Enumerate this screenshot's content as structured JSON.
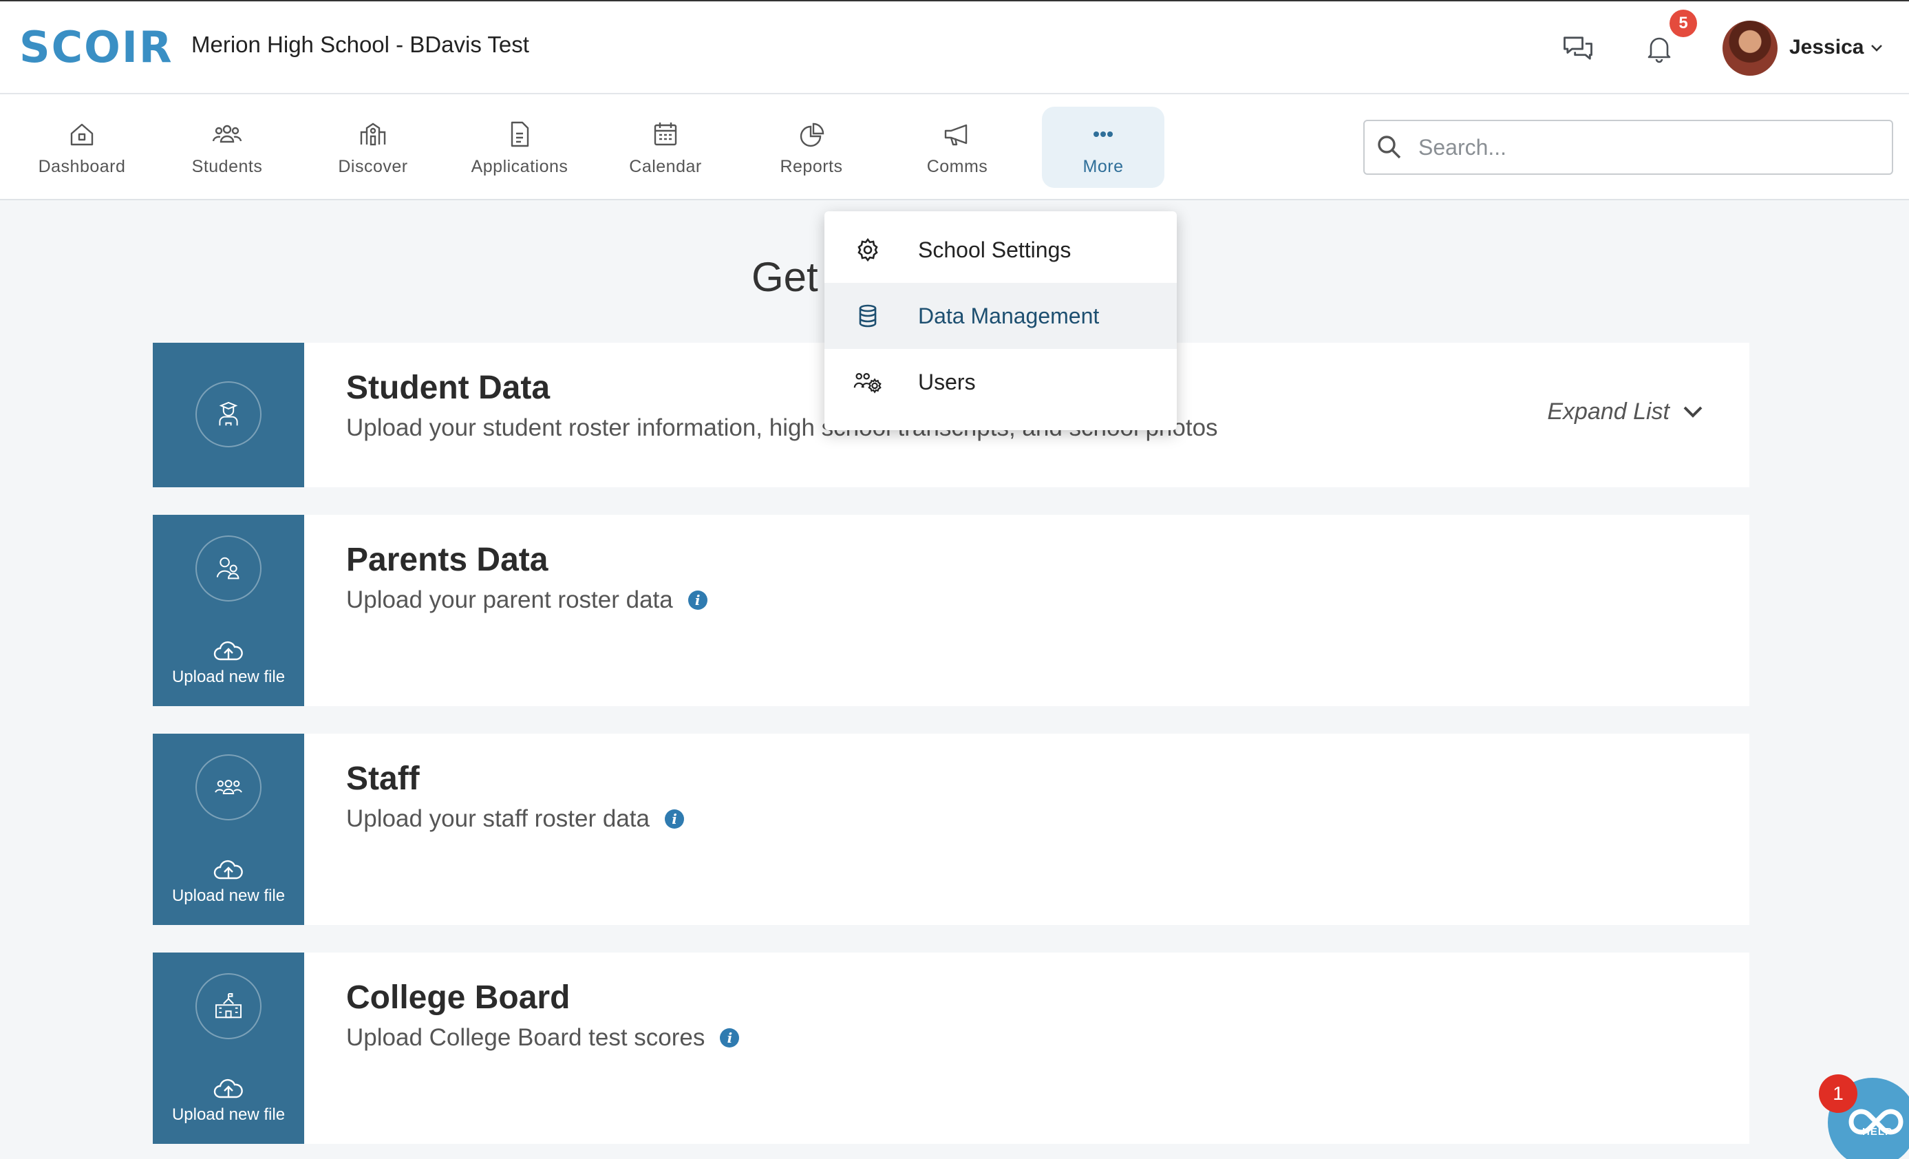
{
  "header": {
    "logo_text": "SCOIR",
    "school_title": "Merion High School - BDavis Test",
    "notifications_count": "5",
    "user_name": "Jessica",
    "icons": [
      "chat-icon",
      "bell-icon",
      "chevron-down-icon"
    ]
  },
  "nav": {
    "items": [
      {
        "label": "Dashboard",
        "icon": "home-icon"
      },
      {
        "label": "Students",
        "icon": "students-icon"
      },
      {
        "label": "Discover",
        "icon": "discover-icon"
      },
      {
        "label": "Applications",
        "icon": "document-icon"
      },
      {
        "label": "Calendar",
        "icon": "calendar-icon"
      },
      {
        "label": "Reports",
        "icon": "pie-chart-icon"
      },
      {
        "label": "Comms",
        "icon": "megaphone-icon"
      },
      {
        "label": "More",
        "icon": "more-dots-icon"
      }
    ],
    "active": "More",
    "search_placeholder": "Search..."
  },
  "more_menu": {
    "items": [
      {
        "label": "School Settings",
        "icon": "gear-icon"
      },
      {
        "label": "Data Management",
        "icon": "database-icon"
      },
      {
        "label": "Users",
        "icon": "users-gear-icon"
      }
    ],
    "highlighted": "Data Management"
  },
  "main": {
    "heading": "Get",
    "cards": [
      {
        "title": "Student Data",
        "subtitle": "Upload your student roster information, high school transcripts, and school photos",
        "action": "Expand List"
      },
      {
        "title": "Parents Data",
        "subtitle": "Upload your parent roster data",
        "upload_label": "Upload new file"
      },
      {
        "title": "Staff",
        "subtitle": "Upload your staff roster data",
        "upload_label": "Upload new file"
      },
      {
        "title": "College Board",
        "subtitle": "Upload College Board test scores",
        "upload_label": "Upload new file"
      }
    ]
  },
  "help": {
    "label": "HELP",
    "badge_count": "1"
  },
  "colors": {
    "brand_blue": "#3a8fc4",
    "card_side": "#356f93",
    "badge_red": "#e44b3d",
    "active_nav_bg": "#e8f1f7"
  }
}
